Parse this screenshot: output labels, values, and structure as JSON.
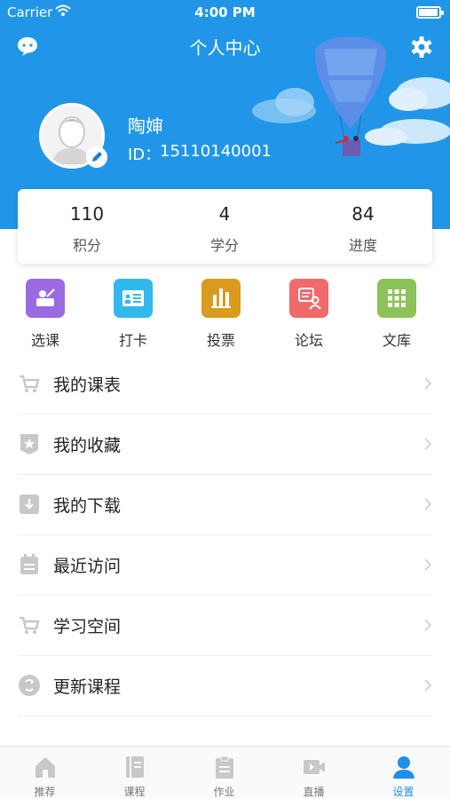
{
  "status_bar": {
    "carrier": "Carrier",
    "time": "4:00 PM"
  },
  "header": {
    "title": "个人中心"
  },
  "profile": {
    "name": "陶婶",
    "id_label": "ID：",
    "id": "15110140001"
  },
  "stats": [
    {
      "value": "110",
      "label": "积分"
    },
    {
      "value": "4",
      "label": "学分"
    },
    {
      "value": "84",
      "label": "进度"
    }
  ],
  "quick_actions": [
    {
      "label": "选课",
      "color": "#9a6be0",
      "icon": "select-course-icon"
    },
    {
      "label": "打卡",
      "color": "#33b8ee",
      "icon": "checkin-icon"
    },
    {
      "label": "投票",
      "color": "#d99a1d",
      "icon": "vote-icon"
    },
    {
      "label": "论坛",
      "color": "#f06a6a",
      "icon": "forum-icon"
    },
    {
      "label": "文库",
      "color": "#8cc25a",
      "icon": "library-icon"
    }
  ],
  "menu": [
    {
      "label": "我的课表",
      "icon": "cart-icon"
    },
    {
      "label": "我的收藏",
      "icon": "star-badge-icon"
    },
    {
      "label": "我的下载",
      "icon": "download-icon"
    },
    {
      "label": "最近访问",
      "icon": "calendar-icon"
    },
    {
      "label": "学习空间",
      "icon": "cart-icon"
    },
    {
      "label": "更新课程",
      "icon": "refresh-icon"
    }
  ],
  "tabs": [
    {
      "label": "推荐",
      "icon": "home-icon"
    },
    {
      "label": "课程",
      "icon": "book-icon"
    },
    {
      "label": "作业",
      "icon": "clipboard-icon"
    },
    {
      "label": "直播",
      "icon": "video-camera-icon"
    },
    {
      "label": "设置",
      "icon": "person-icon",
      "active": true
    }
  ],
  "colors": {
    "primary": "#2196e8",
    "active_tab": "#1e90e8",
    "icon_gray": "#c8c8c8"
  }
}
